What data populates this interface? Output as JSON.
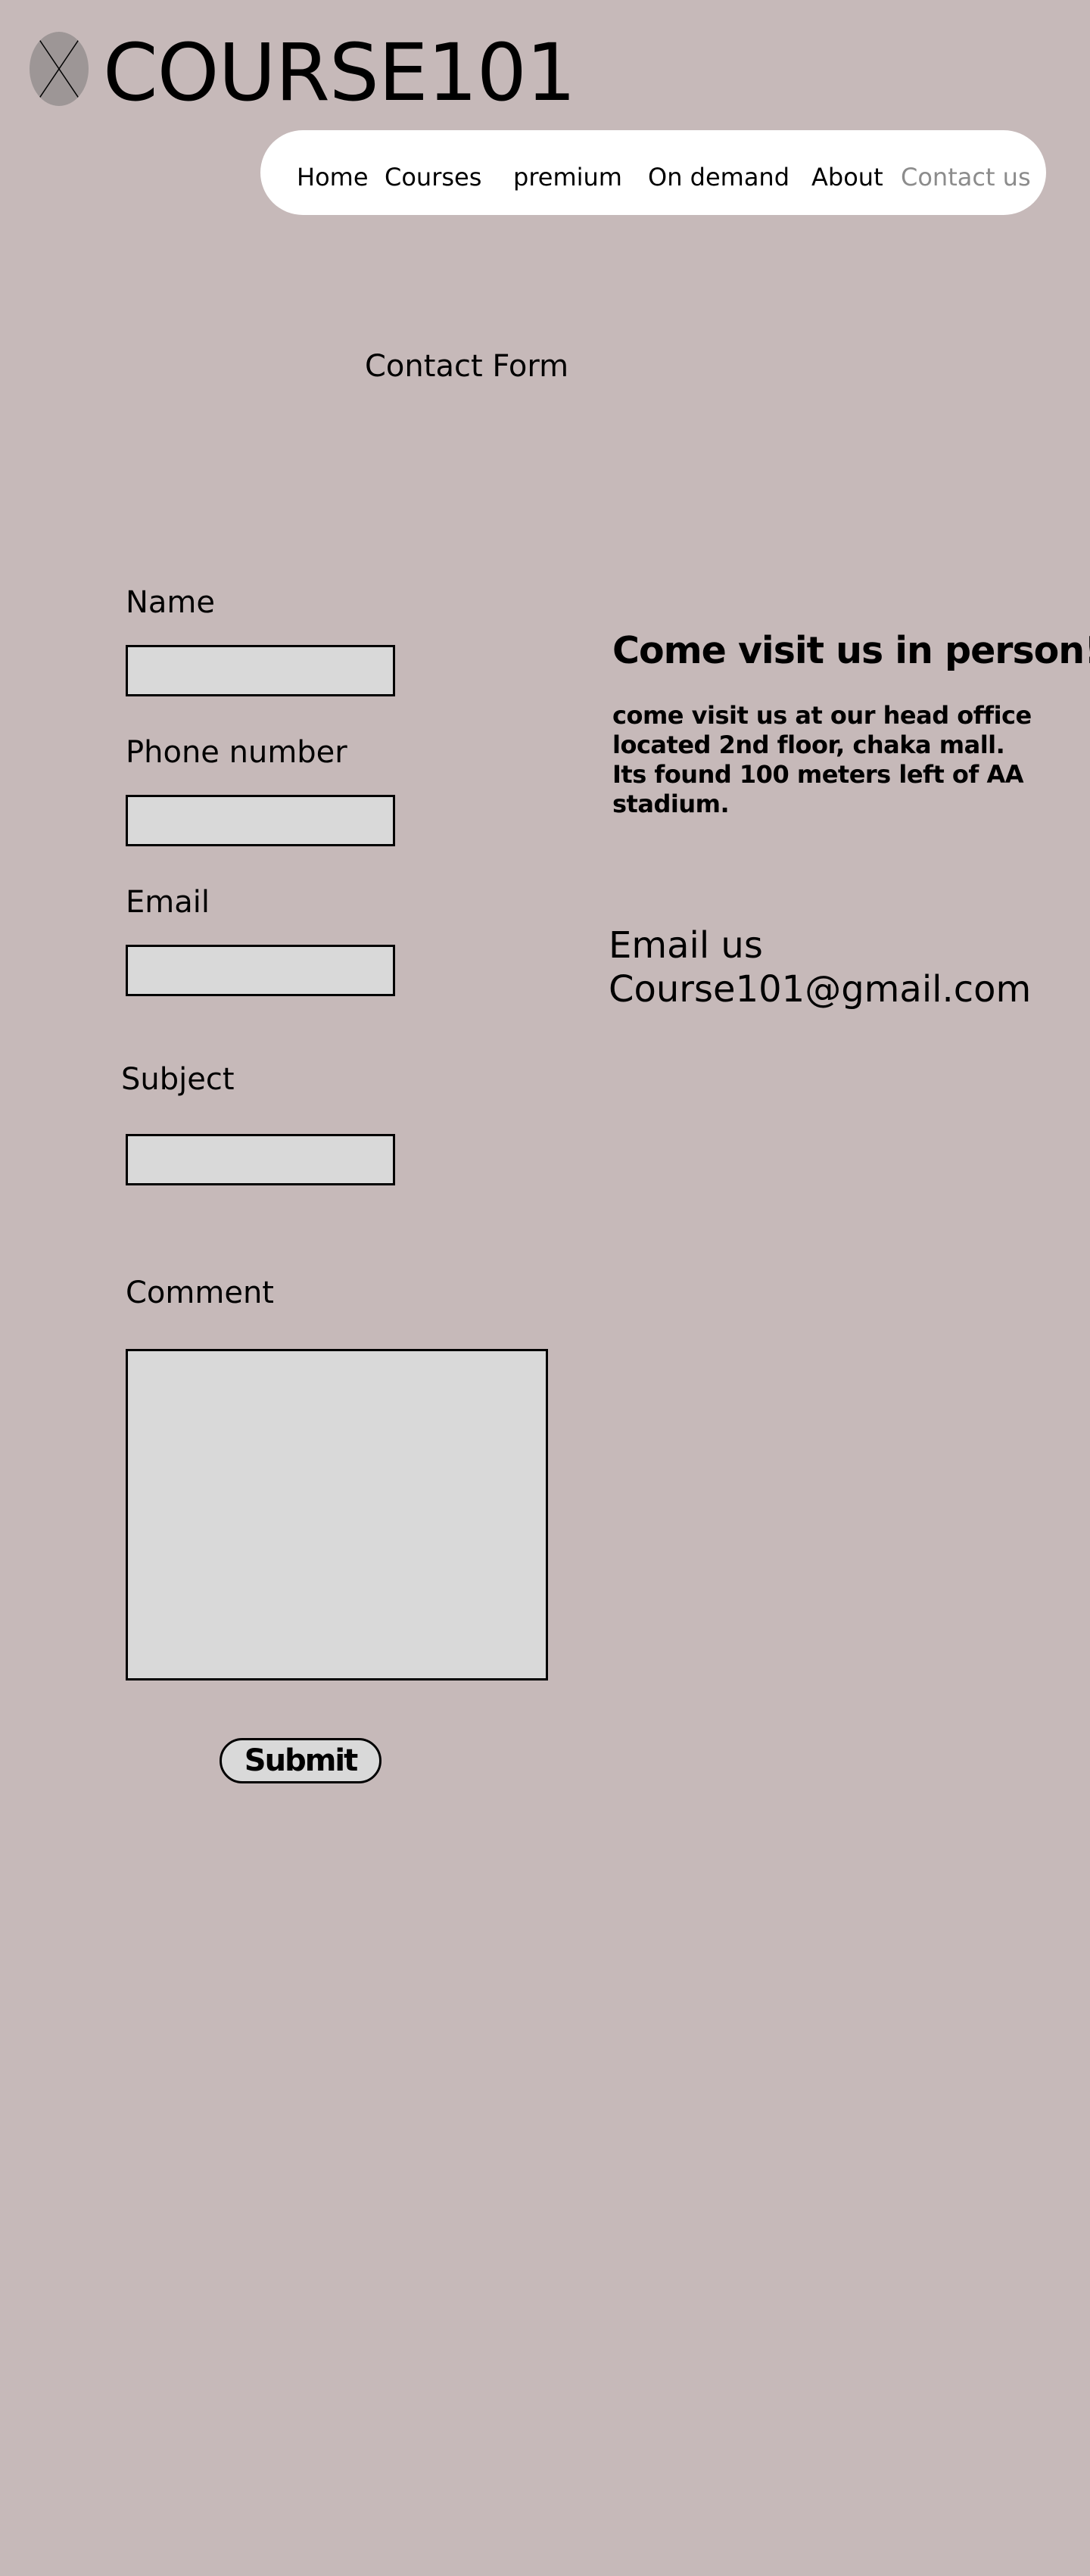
{
  "header": {
    "logo_icon": "placeholder-x-icon",
    "site_title": "COURSE101"
  },
  "nav": {
    "items": [
      {
        "label": "Home"
      },
      {
        "label": "Courses"
      },
      {
        "label": "premium"
      },
      {
        "label": "On demand"
      },
      {
        "label": "About"
      },
      {
        "label": "Contact us",
        "active": true
      }
    ],
    "active_color": "#8c8c8c"
  },
  "form": {
    "heading": "Contact Form",
    "name_label": "Name",
    "phone_label": "Phone number",
    "email_label": "Email",
    "subject_label": "Subject",
    "comment_label": "Comment",
    "submit_label": "Submit"
  },
  "info": {
    "visit_title": "Come visit us in person!",
    "visit_text": "come visit us at our head office located 2nd floor, chaka mall. Its found 100 meters left of AA stadium.",
    "email_label": "Email us",
    "email_address": "Course101@gmail.com"
  },
  "colors": {
    "background": "#c6b9b9",
    "input_fill": "#d9d9d9",
    "nav_background": "#ffffff"
  }
}
